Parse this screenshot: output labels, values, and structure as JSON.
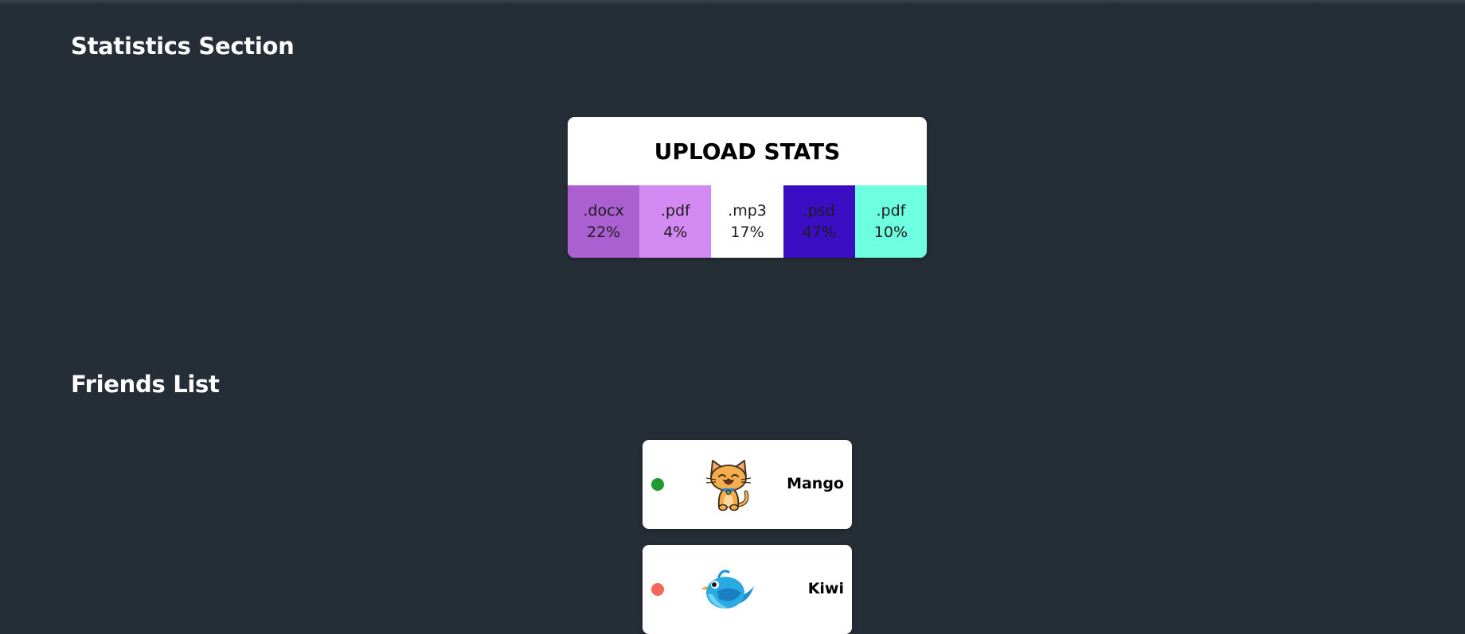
{
  "statistics": {
    "section_title": "Statistics Section",
    "card_title": "UPLOAD STATS",
    "items": [
      {
        "label": ".docx",
        "percentage": "22%",
        "color": "#ab5fd1"
      },
      {
        "label": ".pdf",
        "percentage": "4%",
        "color": "#d289f2"
      },
      {
        "label": ".mp3",
        "percentage": "17%",
        "color": "#ffffff"
      },
      {
        "label": ".psd",
        "percentage": "47%",
        "color": "#3b0ec4"
      },
      {
        "label": ".pdf",
        "percentage": "10%",
        "color": "#6effe1"
      }
    ]
  },
  "friends": {
    "section_title": "Friends List",
    "items": [
      {
        "name": "Mango",
        "status": "online",
        "status_color": "#1e9a2e",
        "avatar_icon": "cat-icon"
      },
      {
        "name": "Kiwi",
        "status": "offline",
        "status_color": "#f36658",
        "avatar_icon": "bird-icon"
      }
    ]
  }
}
